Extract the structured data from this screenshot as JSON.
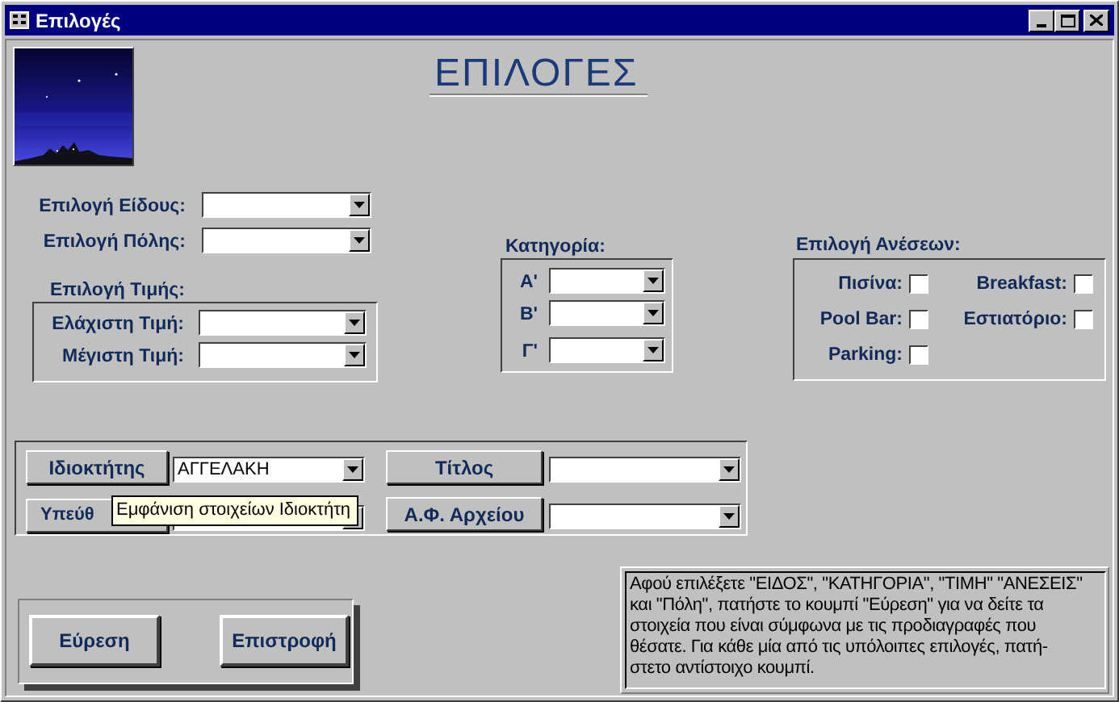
{
  "window": {
    "title": "Επιλογές"
  },
  "heading": "ΕΠΙΛΟΓΕΣ",
  "combos": [
    {
      "label": "Επιλογή Είδους:"
    },
    {
      "label": "Επιλογή Πόλης:"
    }
  ],
  "price": {
    "title": "Επιλογή Τιμής:",
    "fields": [
      {
        "label": "Ελάχιστη Τιμή:"
      },
      {
        "label": "Μέγιστη Τιμή:"
      }
    ]
  },
  "category": {
    "title": "Κατηγορία:",
    "fields": [
      {
        "label": "Α'"
      },
      {
        "label": "Β'"
      },
      {
        "label": "Γ'"
      }
    ]
  },
  "amenities": {
    "title": "Επιλογή Ανέσεων:",
    "items": [
      {
        "label": "Πισίνα:",
        "checked": false
      },
      {
        "label": "Breakfast:",
        "checked": false
      },
      {
        "label": "Pool Bar:",
        "checked": false
      },
      {
        "label": "Εστιατόριο:",
        "checked": false
      },
      {
        "label": "Parking:",
        "checked": false
      }
    ]
  },
  "lookups": [
    {
      "button": "Ιδιοκτήτης",
      "value": "ΑΓΓΕΛΑΚΗ"
    },
    {
      "button": "Τίτλος"
    },
    {
      "button": "Υπεύθ"
    },
    {
      "button": "Α.Φ. Αρχείου"
    }
  ],
  "tooltip": "Εμφάνιση στοιχείων Ιδιοκτήτη",
  "buttons": [
    "Εύρεση",
    "Επιστροφή"
  ],
  "note": "Αφού επιλέξετε \"ΕΙΔΟΣ\", \"ΚΑΤΗΓΟΡΙΑ\", \"ΤΙΜΗ\" \"ΑΝΕΣΕΙΣ\"\nκαι \"Πόλη\", πατήστε το κουμπί \"Εύρεση\" για να δείτε τα\nστοιχεία που είναι σύμφωνα με τις προδιαγραφές που\nθέσατε. Για κάθε μία από τις υπόλοιπες επιλογές, πατή-\nστετο αντίστοιχο κουμπί."
}
